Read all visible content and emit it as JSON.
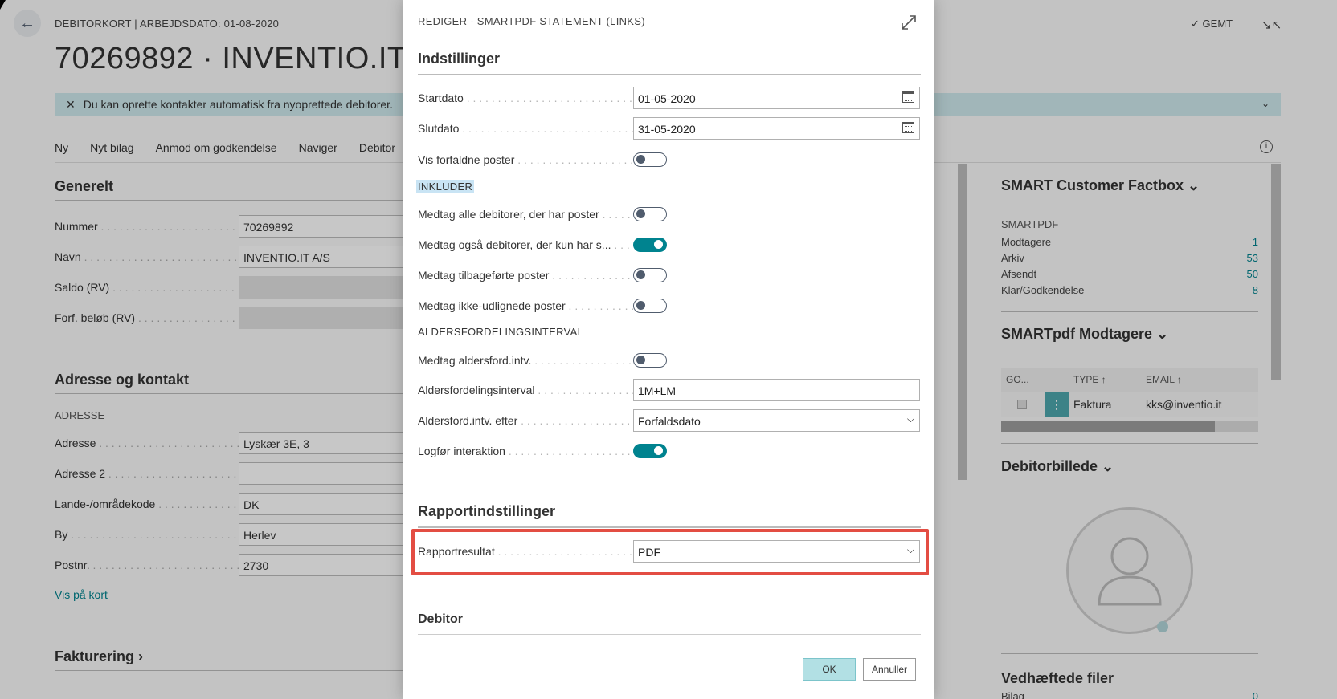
{
  "page": {
    "header_small": "DEBITORKORT | ARBEJDSDATO: 01-08-2020",
    "title": "70269892 · INVENTIO.IT A/S",
    "saved_label": "GEMT",
    "banner_text": "Du kan oprette kontakter automatisk fra nyoprettede debitorer.",
    "actions": [
      "Ny",
      "Nyt bilag",
      "Anmod om godkendelse",
      "Naviger",
      "Debitor"
    ],
    "general": {
      "heading": "Generelt",
      "fields": [
        {
          "label": "Nummer",
          "value": "70269892"
        },
        {
          "label": "Navn",
          "value": "INVENTIO.IT A/S"
        },
        {
          "label": "Saldo (RV)",
          "value": ""
        },
        {
          "label": "Forf. beløb (RV)",
          "value": ""
        }
      ]
    },
    "address": {
      "heading": "Adresse og kontakt",
      "sub": "ADRESSE",
      "fields": [
        {
          "label": "Adresse",
          "value": "Lyskær 3E, 3"
        },
        {
          "label": "Adresse 2",
          "value": ""
        },
        {
          "label": "Lande-/områdekode",
          "value": "DK"
        },
        {
          "label": "By",
          "value": "Herlev"
        },
        {
          "label": "Postnr.",
          "value": "2730"
        }
      ],
      "map_link": "Vis på kort"
    },
    "invoicing_heading": "Fakturering"
  },
  "factbox": {
    "title": "SMART Customer Factbox",
    "sub": "SMARTPDF",
    "stats": [
      {
        "label": "Modtagere",
        "value": "1"
      },
      {
        "label": "Arkiv",
        "value": "53"
      },
      {
        "label": "Afsendt",
        "value": "50"
      },
      {
        "label": "Klar/Godkendelse",
        "value": "8"
      }
    ],
    "recipients_title": "SMARTpdf Modtagere",
    "table_headers": [
      "GO...",
      "TYPE ↑",
      "EMAIL ↑"
    ],
    "table_row": {
      "type": "Faktura",
      "email": "kks@inventio.it"
    },
    "picture_title": "Debitorbillede",
    "attachments_title": "Vedhæftede filer",
    "attachments_row": {
      "label": "Bilag",
      "value": "0"
    }
  },
  "dialog": {
    "title": "REDIGER - SMARTPDF STATEMENT (LINKS)",
    "settings_heading": "Indstillinger",
    "start_label": "Startdato",
    "start_value": "01-05-2020",
    "end_label": "Slutdato",
    "end_value": "31-05-2020",
    "show_overdue_label": "Vis forfaldne poster",
    "include_heading": "INKLUDER",
    "include_all_label": "Medtag alle debitorer, der har poster",
    "include_also_label": "Medtag også debitorer, der kun har s...",
    "include_reversed_label": "Medtag tilbageførte poster",
    "include_unapplied_label": "Medtag ikke-udlignede poster",
    "aging_heading": "ALDERSFORDELINGSINTERVAL",
    "include_aging_label": "Medtag aldersford.intv.",
    "aging_interval_label": "Aldersfordelingsinterval",
    "aging_interval_value": "1M+LM",
    "aging_by_label": "Aldersford.intv. efter",
    "aging_by_value": "Forfaldsdato",
    "log_label": "Logfør interaktion",
    "toggles": {
      "show_overdue": false,
      "include_all": false,
      "include_also": true,
      "include_reversed": false,
      "include_unapplied": false,
      "include_aging": false,
      "log_interaction": true
    },
    "report_heading": "Rapportindstillinger",
    "report_result_label": "Rapportresultat",
    "report_result_value": "PDF",
    "debitor_heading": "Debitor",
    "ok_label": "OK",
    "cancel_label": "Annuller",
    "highlight_color": "#e34d43",
    "accent_color": "#00838f"
  }
}
